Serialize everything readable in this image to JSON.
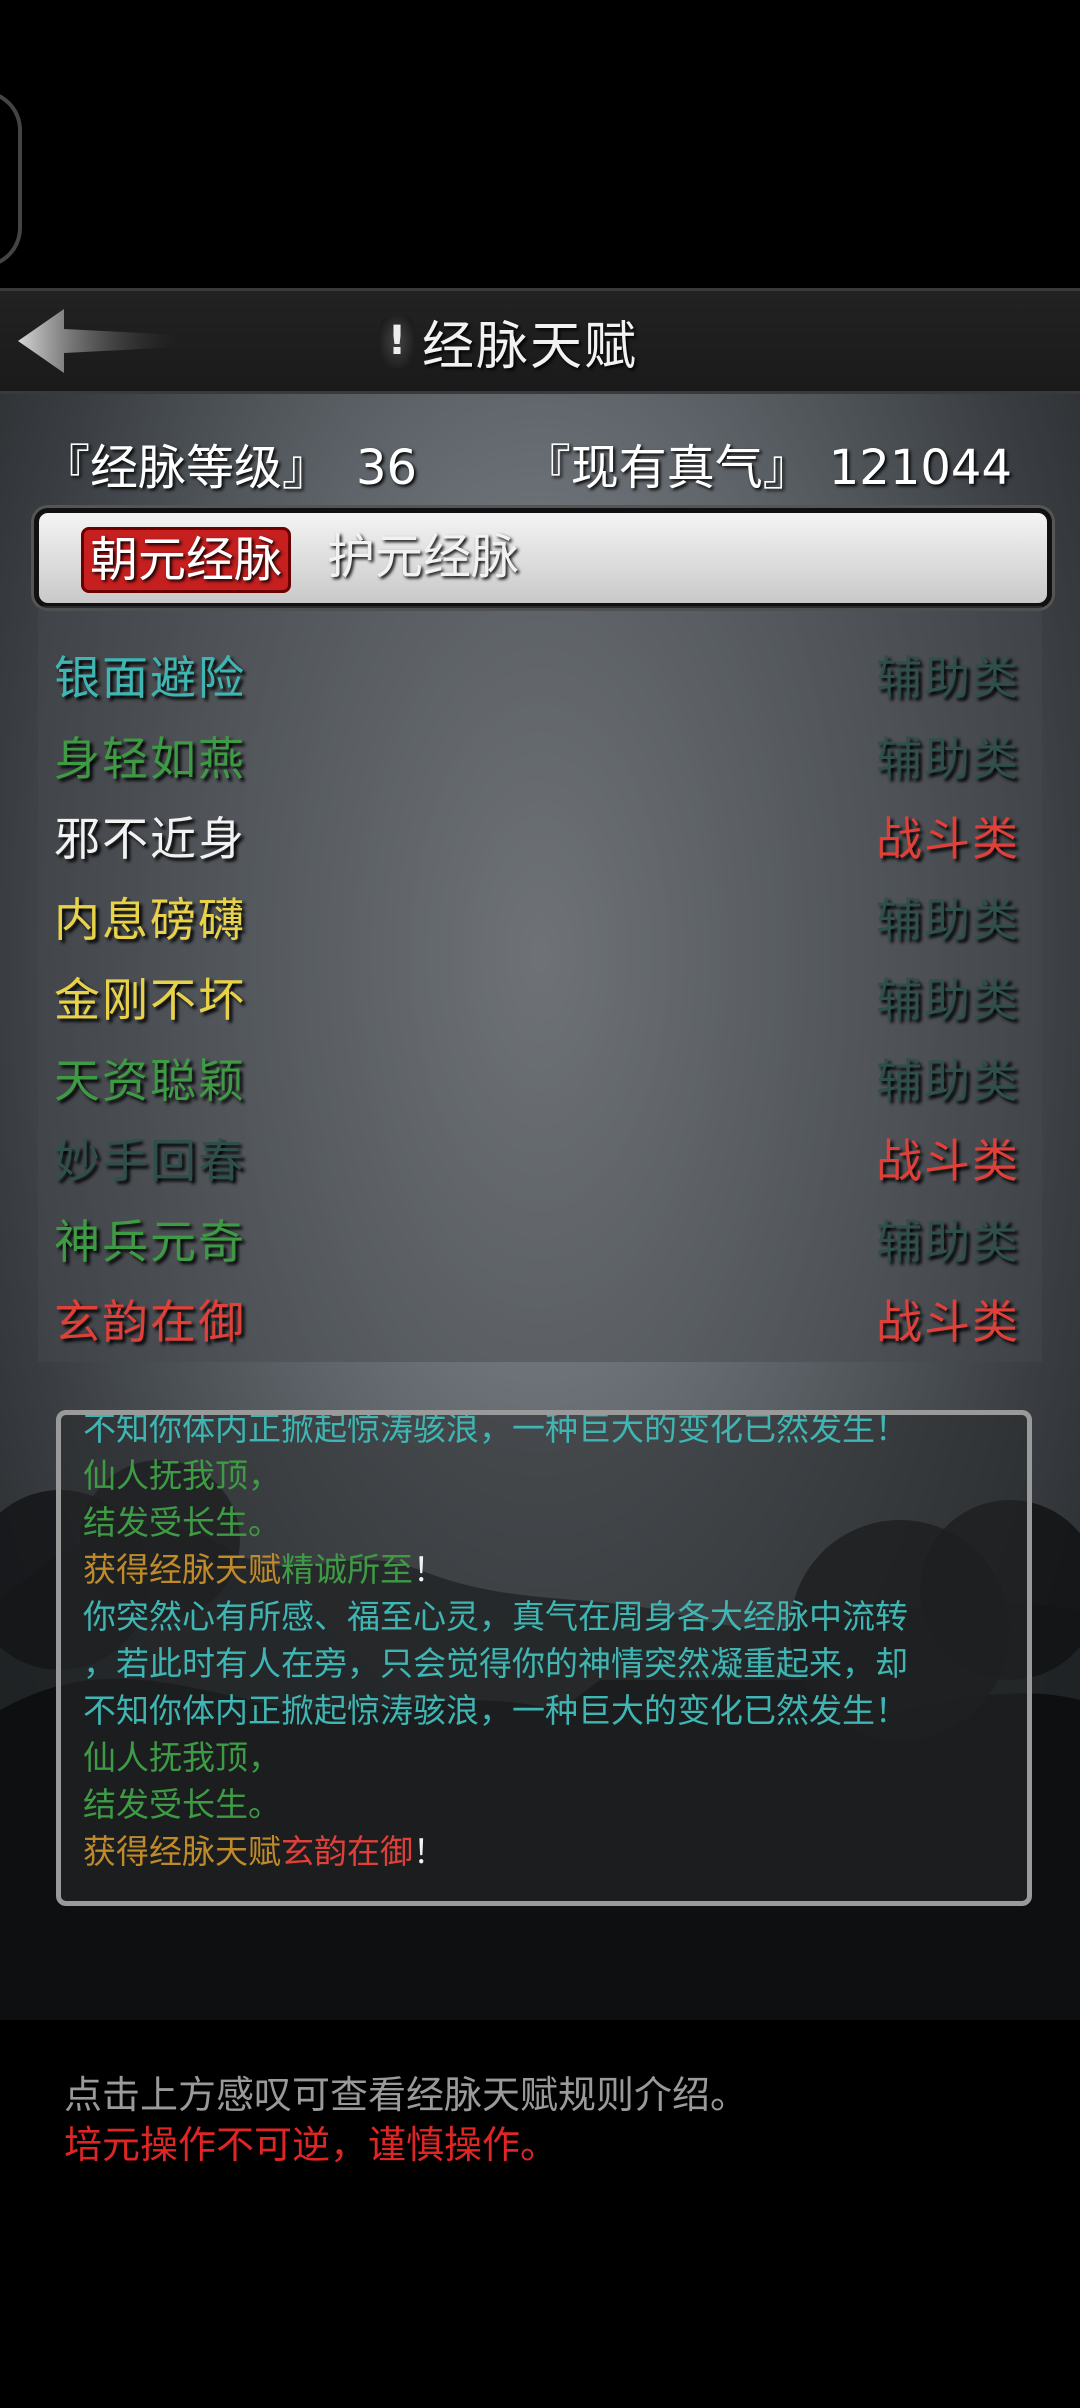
{
  "header": {
    "title": "经脉天赋",
    "info_icon_text": "!"
  },
  "stats": {
    "level_label": "『经脉等级』",
    "level_value": "36",
    "qi_label": "『现有真气』",
    "qi_value": "121044"
  },
  "tabs": [
    {
      "label": "朝元经脉",
      "active": true
    },
    {
      "label": "护元经脉",
      "active": false
    }
  ],
  "talents": [
    {
      "name": "银面避险",
      "category": "辅助类",
      "name_color": "#3fb6b3",
      "category_color": "#2f4f4d"
    },
    {
      "name": "身轻如燕",
      "category": "辅助类",
      "name_color": "#3f9a45",
      "category_color": "#2f4f4d"
    },
    {
      "name": "邪不近身",
      "category": "战斗类",
      "name_color": "#f2f2f2",
      "category_color": "#e0403a"
    },
    {
      "name": "内息磅礴",
      "category": "辅助类",
      "name_color": "#e8d24a",
      "category_color": "#2f4f4d"
    },
    {
      "name": "金刚不坏",
      "category": "辅助类",
      "name_color": "#e8d24a",
      "category_color": "#2f4f4d"
    },
    {
      "name": "天资聪颖",
      "category": "辅助类",
      "name_color": "#3f9a45",
      "category_color": "#2f4f4d"
    },
    {
      "name": "妙手回春",
      "category": "战斗类",
      "name_color": "#2f4f4d",
      "category_color": "#e0403a"
    },
    {
      "name": "神兵元奇",
      "category": "辅助类",
      "name_color": "#3f9a45",
      "category_color": "#2f4f4d"
    },
    {
      "name": "玄韵在御",
      "category": "战斗类",
      "name_color": "#e0403a",
      "category_color": "#e0403a"
    }
  ],
  "log": {
    "line1": "不知你体内正掀起惊涛骇浪，一种巨大的变化已然发生！",
    "line2": "仙人抚我顶，",
    "line3": "结发受长生。",
    "line4_prefix": "获得经脉天赋",
    "line4_talent": "精诚所至",
    "line4_suffix": "！",
    "line5": "你突然心有所感、福至心灵，真气在周身各大经脉中流转",
    "line6": "，若此时有人在旁，只会觉得你的神情突然凝重起来，却",
    "line7": "不知你体内正掀起惊涛骇浪，一种巨大的变化已然发生！",
    "line8": "仙人抚我顶，",
    "line9": "结发受长生。",
    "line10_prefix": "获得经脉天赋",
    "line10_talent": "玄韵在御",
    "line10_suffix": "！"
  },
  "footer": {
    "hint": "点击上方感叹可查看经脉天赋规则介绍。",
    "warning": "培元操作不可逆，谨慎操作。"
  }
}
